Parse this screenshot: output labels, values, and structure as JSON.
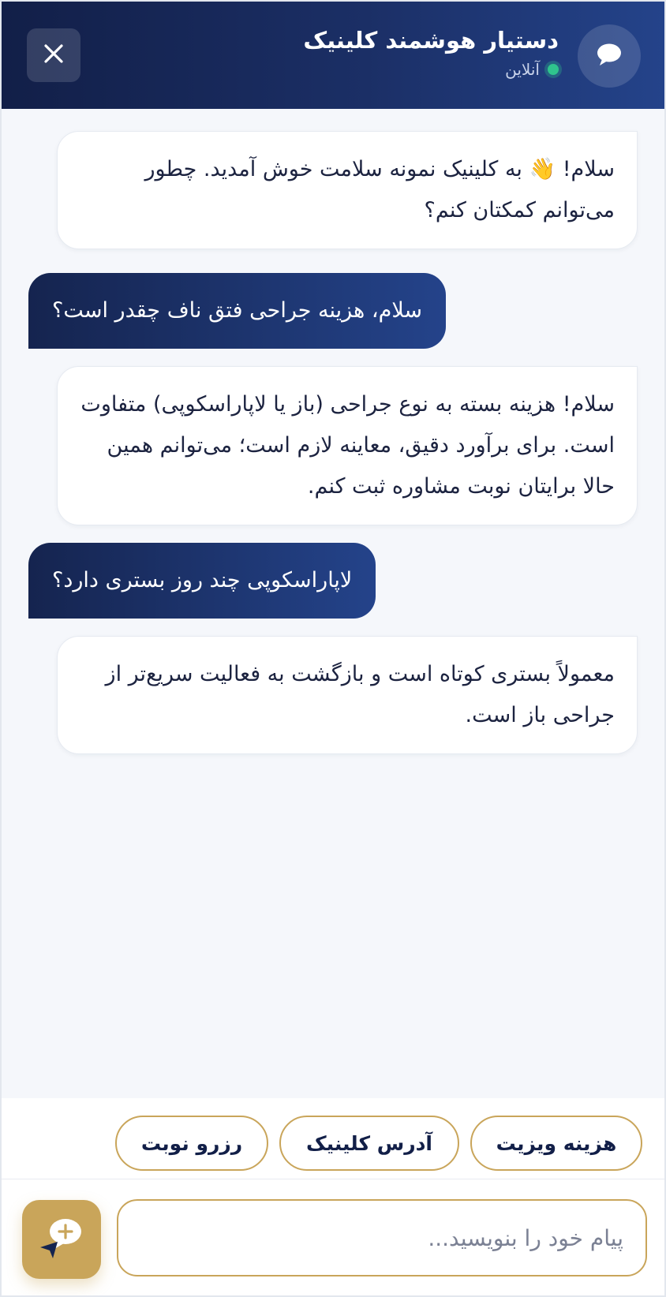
{
  "header": {
    "title": "دستیار هوشمند کلینیک",
    "status": "آنلاین",
    "avatar_icon": "chat-bubble-icon",
    "close_icon": "close-icon"
  },
  "messages": [
    {
      "sender": "bot",
      "text": "سلام! 👋 به کلینیک نمونه سلامت خوش آمدید. چطور می‌توانم کمکتان کنم؟"
    },
    {
      "sender": "user",
      "text": "سلام، هزینه جراحی فتق ناف چقدر است؟"
    },
    {
      "sender": "bot",
      "text": "سلام! هزینه بسته به نوع جراحی (باز یا لاپاراسکوپی) متفاوت است. برای برآورد دقیق، معاینه لازم است؛ می‌توانم همین حالا برایتان نوبت مشاوره ثبت کنم."
    },
    {
      "sender": "user",
      "text": "لاپاراسکوپی چند روز بستری دارد؟"
    },
    {
      "sender": "bot",
      "text": "معمولاً بستری کوتاه است و بازگشت به فعالیت سریع‌تر از جراحی باز است."
    }
  ],
  "quick_replies": [
    "هزینه ویزیت",
    "آدرس کلینیک",
    "رزرو نوبت"
  ],
  "input": {
    "placeholder": "پیام خود را بنویسید...",
    "value": ""
  },
  "send_icon": "send-chat-icon",
  "colors": {
    "header_start": "#121f48",
    "header_end": "#24438a",
    "accent_gold": "#c9a55a",
    "online": "#2fc48d",
    "background": "#f5f7fb"
  }
}
